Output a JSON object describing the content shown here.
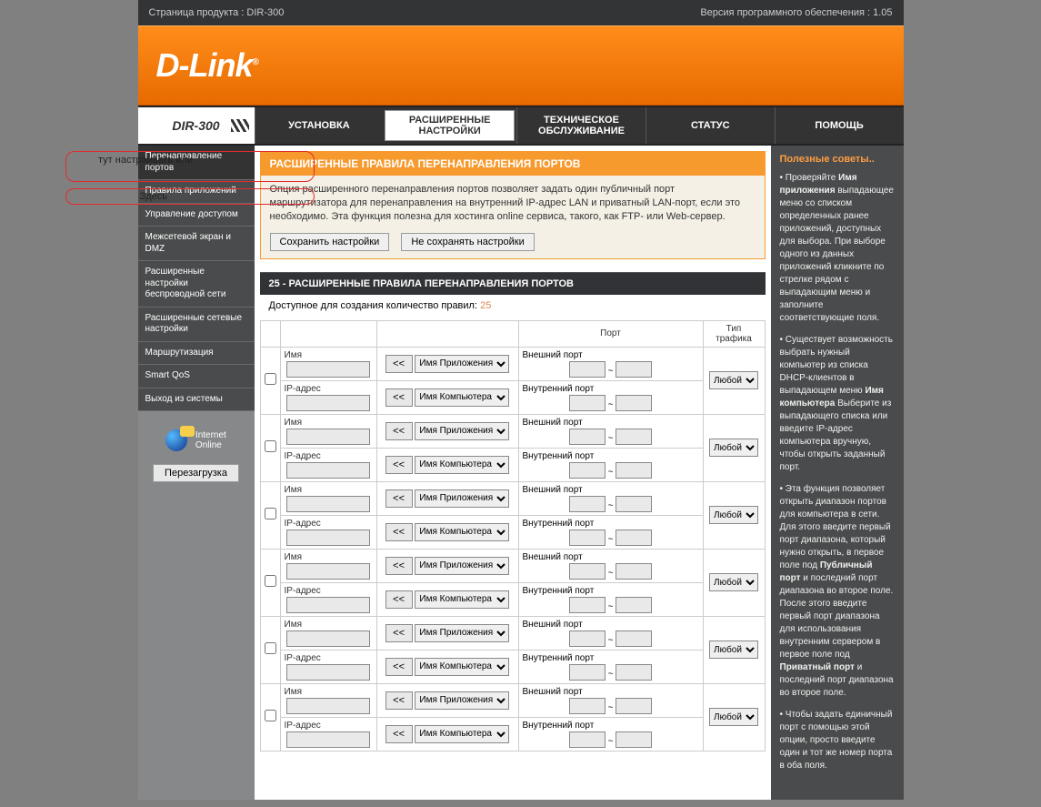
{
  "top": {
    "product_page": "Страница продукта :  DIR-300",
    "fw_version": "Версия программного обеспечения : 1.05"
  },
  "logo_text": "D-Link",
  "device_model": "DIR-300",
  "nav": {
    "install": "УСТАНОВКА",
    "advanced": "РАСШИРЕННЫЕ НАСТРОЙКИ",
    "maintenance": "ТЕХНИЧЕСКОЕ ОБСЛУЖИВАНИЕ",
    "status": "СТАТУС",
    "help": "ПОМОЩЬ"
  },
  "sidebar": {
    "items": [
      "Перенаправление портов",
      "Правила приложений",
      "Управление доступом",
      "Межсетевой экран и DMZ",
      "Расширенные настройки беспроводной сети",
      "Расширенные сетевые настройки",
      "Маршрутизация",
      "Smart QoS",
      "Выход из системы"
    ],
    "internet_label": "Internet",
    "internet_status": "Online",
    "reboot": "Перезагрузка"
  },
  "intro": {
    "header": "РАСШИРЕННЫЕ ПРАВИЛА ПЕРЕНАПРАВЛЕНИЯ ПОРТОВ",
    "text": "Опция расширенного перенаправления портов позволяет задать один публичный порт маршрутизатора для перенаправления на внутренний IP-адрес LAN и приватный LAN-порт, если это необходимо. Эта функция полезна для хостинга online сервиса, такого, как FTP- или Web-сервер.",
    "save": "Сохранить настройки",
    "dont_save": "Не сохранять настройки"
  },
  "section_title": "25 - РАСШИРЕННЫЕ ПРАВИЛА ПЕРЕНАПРАВЛЕНИЯ ПОРТОВ",
  "avail": {
    "label": "Доступное для создания количество правил: ",
    "count": "25"
  },
  "table": {
    "col_port": "Порт",
    "col_traffic": "Тип трафика",
    "name_label": "Имя",
    "ip_label": "IP-адрес",
    "ext_port": "Внешний порт",
    "int_port": "Внутренний порт",
    "tilde": "~",
    "arrow": "<<",
    "app_select": "Имя Приложения",
    "comp_select": "Имя Компьютера",
    "traffic_any": "Любой",
    "rows": 6
  },
  "tips": {
    "title": "Полезные советы..",
    "app_name_b": "Имя приложения",
    "comp_name_b": "Имя компьютера",
    "public_b": "Публичный порт",
    "private_b": "Приватный порт",
    "p1a": "Проверяйте ",
    "p1b": " выпадающее меню со списком определенных ранее приложений, доступных для выбора. При выборе одного из данных приложений кликните по стрелке рядом с выпадающим меню и заполните соответствующие поля.",
    "p2a": "Существует возможность выбрать нужный компьютер из списка DHCP-клиентов в выпадающем меню ",
    "p2b": " Выберите из выпадающего списка или введите IP-адрес компьютера вручную, чтобы открыть заданный порт.",
    "p3a": "Эта функция позволяет открыть диапазон портов для компьютера в сети. Для этого введите первый порт диапазона, который нужно открыть, в первое поле под ",
    "p3b": " и последний порт диапазона во второе поле. После этого введите первый порт диапазона для использования внутренним сервером в первое поле под ",
    "p3c": " и последний порт диапазона во второе поле.",
    "p4": "Чтобы задать единичный порт с помощью этой опции, просто введите один и тот же номер порта в оба поля."
  },
  "callouts": {
    "c1": "тут настраивать или",
    "c2": "Здесь"
  }
}
